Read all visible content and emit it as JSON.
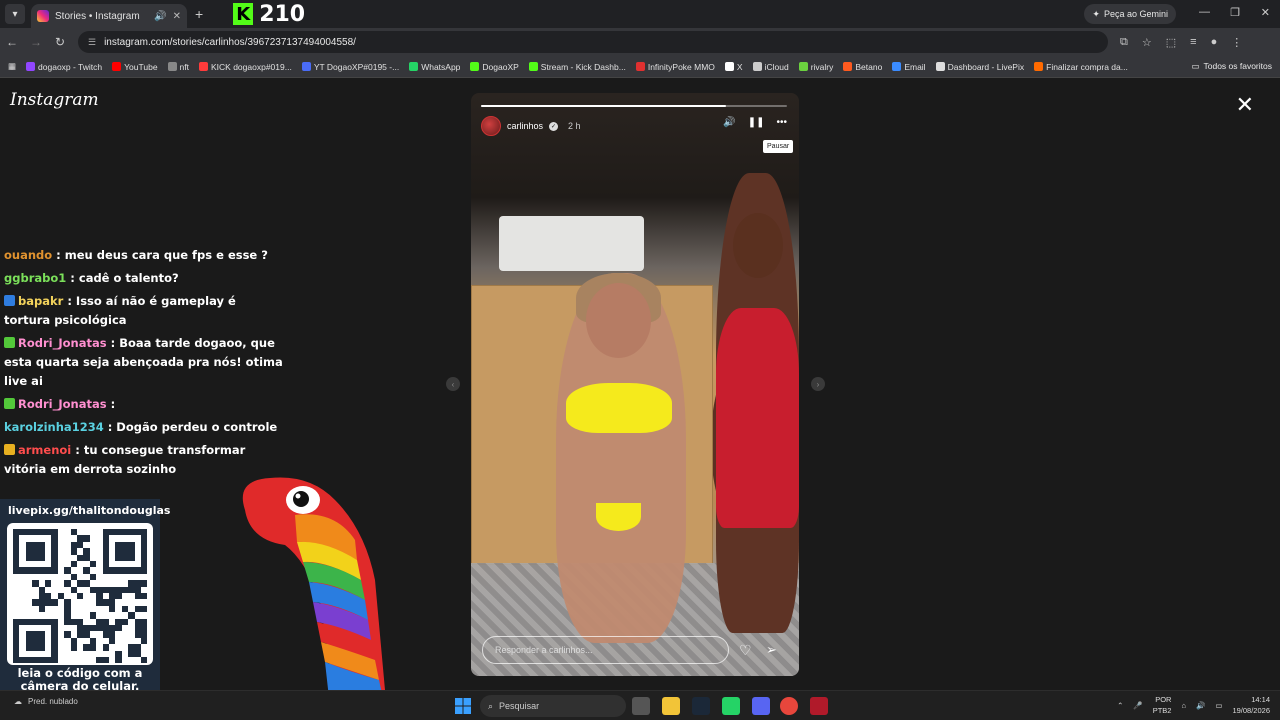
{
  "browser": {
    "tab_title": "Stories • Instagram",
    "kick_viewers": "210",
    "gemini_label": "Peça ao Gemini",
    "url": "instagram.com/stories/carlinhos/3967237137494004558/",
    "bookmarks": [
      {
        "label": "dogaoxp - Twitch",
        "color": "#9146ff"
      },
      {
        "label": "YouTube",
        "color": "#ff0000"
      },
      {
        "label": "nft",
        "color": "#888888"
      },
      {
        "label": "KICK dogaoxp#019...",
        "color": "#ff3b3b"
      },
      {
        "label": "YT DogaoXP#0195 -...",
        "color": "#4a6cf7"
      },
      {
        "label": "WhatsApp",
        "color": "#25d366"
      },
      {
        "label": "DogaoXP",
        "color": "#53fc18"
      },
      {
        "label": "Stream - Kick Dashb...",
        "color": "#53fc18"
      },
      {
        "label": "InfinityPoke MMO",
        "color": "#e03030"
      },
      {
        "label": "X",
        "color": "#ffffff"
      },
      {
        "label": "iCloud",
        "color": "#cccccc"
      },
      {
        "label": "rivalry",
        "color": "#6bd13f"
      },
      {
        "label": "Betano",
        "color": "#ff5a1f"
      },
      {
        "label": "Email",
        "color": "#3b8cff"
      },
      {
        "label": "Dashboard - LivePix",
        "color": "#dddddd"
      },
      {
        "label": "Finalizar compra da...",
        "color": "#ff6a00"
      }
    ],
    "all_bookmarks_label": "Todos os favoritos"
  },
  "instagram": {
    "logo": "Instagram",
    "story": {
      "username": "carlinhos",
      "time": "2 h",
      "progress": 0.8,
      "pause_tooltip": "Pausar",
      "reply_placeholder": "Responder a carlinhos..."
    }
  },
  "chat": [
    {
      "user": "ouando",
      "text": ": meu deus cara que fps e esse ?",
      "user_color": "#e0922f",
      "badge": ""
    },
    {
      "user": "ggbrabo1",
      "text": ": cadê o talento?",
      "user_color": "#7be05a",
      "badge": ""
    },
    {
      "user": "bapakr",
      "text": ": Isso aí não é gameplay é tortura psicológica",
      "user_color": "#f2d25c",
      "badge": "#2f7de0"
    },
    {
      "user": "Rodri_Jonatas",
      "text": ": Boaa tarde dogaoo, que esta quarta seja abençoada pra nós! otima live ai",
      "user_color": "#ff8fd0",
      "badge": "#53c83a"
    },
    {
      "user": "Rodri_Jonatas",
      "text": ":",
      "user_color": "#ff8fd0",
      "badge": "#53c83a"
    },
    {
      "user": "karolzinha1234",
      "text": ": Dogão perdeu o controle",
      "user_color": "#5ad0e0",
      "badge": ""
    },
    {
      "user": "armenoi",
      "text": ": tu consegue transformar vitória em derrota sozinho",
      "user_color": "#ff4d4d",
      "badge": "#e8b020"
    }
  ],
  "livepix": {
    "url": "livepix.gg/thalitondouglas",
    "caption": "leia o código com a câmera do celular."
  },
  "taskbar": {
    "weather": "Pred. nublado",
    "search_placeholder": "Pesquisar",
    "lang": "POR",
    "lang_sub": "PTB2",
    "time": "14:14",
    "date": "19/08/2026"
  }
}
